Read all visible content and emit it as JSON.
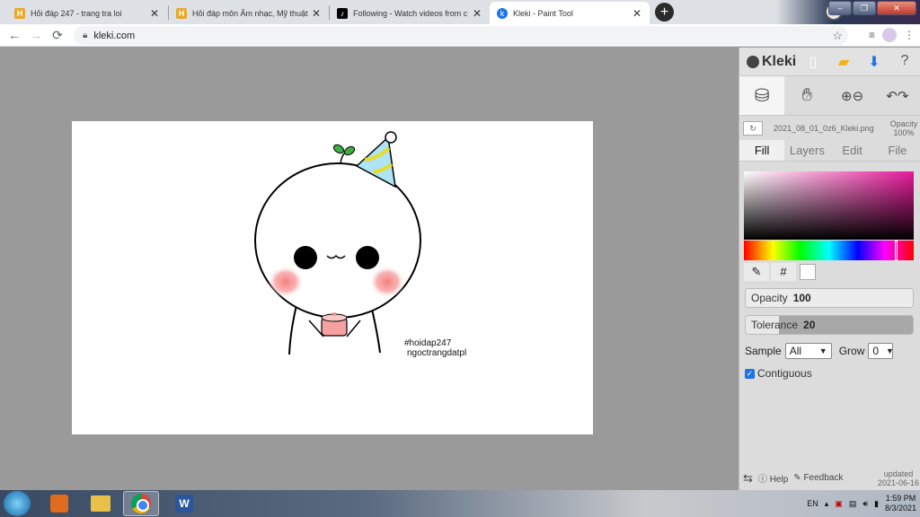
{
  "browser": {
    "tabs": [
      {
        "title": "Hỏi đáp 247 - trang tra loi",
        "icon": "h-favicon",
        "active": false
      },
      {
        "title": "Hỏi đáp môn Âm nhạc, Mỹ thuật",
        "icon": "h-favicon",
        "active": false
      },
      {
        "title": "Following - Watch videos from c",
        "icon": "tiktok-favicon",
        "active": false
      },
      {
        "title": "Kleki - Paint Tool",
        "icon": "kleki-favicon",
        "active": true
      }
    ],
    "url": "kleki.com"
  },
  "canvas": {
    "watermark_line1": "#hoidap247",
    "watermark_line2": "ngoctrangdatpl"
  },
  "kleki": {
    "logo": "Kleki",
    "file_name": "2021_08_01_0z6_Kleki.png",
    "opacity_label": "Opacity",
    "opacity_value": "100%",
    "tabs": [
      "Fill",
      "Layers",
      "Edit",
      "File"
    ],
    "active_tab": "Fill",
    "hex_button": "#",
    "opacity_slider_label": "Opacity",
    "opacity_slider_value": "100",
    "tolerance_label": "Tolerance",
    "tolerance_value": "20",
    "sample_label": "Sample",
    "sample_value": "All",
    "grow_label": "Grow",
    "grow_value": "0",
    "contiguous_label": "Contiguous",
    "contiguous_checked": true,
    "help_label": "Help",
    "feedback_label": "Feedback",
    "updated_label": "updated",
    "updated_date": "2021-06-16",
    "colors": {
      "hue_selected": "#e8199a"
    }
  },
  "taskbar": {
    "language": "EN",
    "time": "1:59 PM",
    "date": "8/3/2021"
  }
}
